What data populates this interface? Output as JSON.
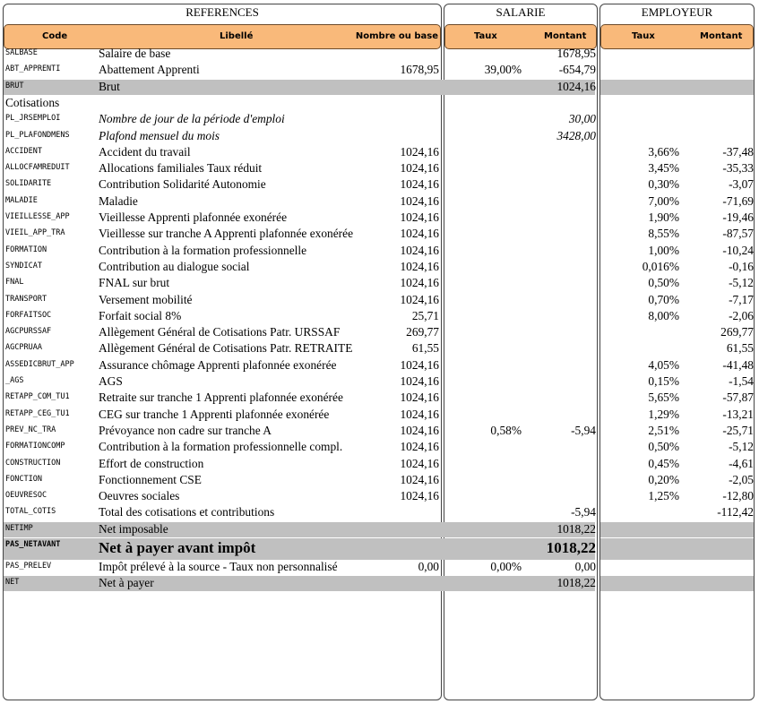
{
  "panels": {
    "references": "REFERENCES",
    "salarie": "SALARIE",
    "employeur": "EMPLOYEUR"
  },
  "headers": {
    "code": "Code",
    "libelle": "Libellé",
    "base": "Nombre ou base",
    "sal_taux": "Taux",
    "sal_montant": "Montant",
    "emp_taux": "Taux",
    "emp_montant": "Montant"
  },
  "rows": [
    {
      "code": "SALBASE",
      "libelle": "Salaire de base",
      "base": "",
      "sal_taux": "",
      "sal_montant": "1678,95",
      "emp_taux": "",
      "emp_montant": ""
    },
    {
      "code": "ABT_APPRENTI",
      "libelle": "Abattement Apprenti",
      "base": "1678,95",
      "sal_taux": "39,00%",
      "sal_montant": "-654,79",
      "emp_taux": "",
      "emp_montant": ""
    },
    {
      "code": "BRUT",
      "libelle": "Brut",
      "base": "",
      "sal_taux": "",
      "sal_montant": "1024,16",
      "emp_taux": "",
      "emp_montant": "",
      "style": "shaded"
    },
    {
      "code": "",
      "libelle": "Cotisations",
      "base": "",
      "sal_taux": "",
      "sal_montant": "",
      "emp_taux": "",
      "emp_montant": "",
      "style": "section"
    },
    {
      "code": "PL_JRSEMPLOI",
      "libelle": "Nombre de jour de la période d'emploi",
      "base": "",
      "sal_taux": "",
      "sal_montant": "30,00",
      "emp_taux": "",
      "emp_montant": "",
      "style": "italic"
    },
    {
      "code": "PL_PLAFONDMENS",
      "libelle": "Plafond mensuel du mois",
      "base": "",
      "sal_taux": "",
      "sal_montant": "3428,00",
      "emp_taux": "",
      "emp_montant": "",
      "style": "italic"
    },
    {
      "code": "ACCIDENT",
      "libelle": "Accident du travail",
      "base": "1024,16",
      "sal_taux": "",
      "sal_montant": "",
      "emp_taux": "3,66%",
      "emp_montant": "-37,48"
    },
    {
      "code": "ALLOCFAMREDUIT",
      "libelle": "Allocations familiales Taux réduit",
      "base": "1024,16",
      "sal_taux": "",
      "sal_montant": "",
      "emp_taux": "3,45%",
      "emp_montant": "-35,33"
    },
    {
      "code": "SOLIDARITE",
      "libelle": "Contribution Solidarité Autonomie",
      "base": "1024,16",
      "sal_taux": "",
      "sal_montant": "",
      "emp_taux": "0,30%",
      "emp_montant": "-3,07"
    },
    {
      "code": "MALADIE",
      "libelle": "Maladie",
      "base": "1024,16",
      "sal_taux": "",
      "sal_montant": "",
      "emp_taux": "7,00%",
      "emp_montant": "-71,69"
    },
    {
      "code": "VIEILLESSE_APP",
      "libelle": "Vieillesse Apprenti plafonnée exonérée",
      "base": "1024,16",
      "sal_taux": "",
      "sal_montant": "",
      "emp_taux": "1,90%",
      "emp_montant": "-19,46"
    },
    {
      "code": "VIEIL_APP_TRA",
      "libelle": "Vieillesse sur tranche A Apprenti plafonnée exonérée",
      "base": "1024,16",
      "sal_taux": "",
      "sal_montant": "",
      "emp_taux": "8,55%",
      "emp_montant": "-87,57"
    },
    {
      "code": "FORMATION",
      "libelle": "Contribution à la formation professionnelle",
      "base": "1024,16",
      "sal_taux": "",
      "sal_montant": "",
      "emp_taux": "1,00%",
      "emp_montant": "-10,24"
    },
    {
      "code": "SYNDICAT",
      "libelle": "Contribution au dialogue social",
      "base": "1024,16",
      "sal_taux": "",
      "sal_montant": "",
      "emp_taux": "0,016%",
      "emp_montant": "-0,16"
    },
    {
      "code": "FNAL",
      "libelle": "FNAL sur brut",
      "base": "1024,16",
      "sal_taux": "",
      "sal_montant": "",
      "emp_taux": "0,50%",
      "emp_montant": "-5,12"
    },
    {
      "code": "TRANSPORT",
      "libelle": "Versement mobilité",
      "base": "1024,16",
      "sal_taux": "",
      "sal_montant": "",
      "emp_taux": "0,70%",
      "emp_montant": "-7,17"
    },
    {
      "code": "FORFAITSOC",
      "libelle": "Forfait social  8%",
      "base": "25,71",
      "sal_taux": "",
      "sal_montant": "",
      "emp_taux": "8,00%",
      "emp_montant": "-2,06"
    },
    {
      "code": "AGCPURSSAF",
      "libelle": "Allègement Général de Cotisations Patr. URSSAF",
      "base": "269,77",
      "sal_taux": "",
      "sal_montant": "",
      "emp_taux": "",
      "emp_montant": "269,77"
    },
    {
      "code": "AGCPRUAA",
      "libelle": "Allègement Général de Cotisations Patr. RETRAITE",
      "base": "61,55",
      "sal_taux": "",
      "sal_montant": "",
      "emp_taux": "",
      "emp_montant": "61,55"
    },
    {
      "code": "ASSEDICBRUT_APP",
      "libelle": "Assurance chômage Apprenti plafonnée exonérée",
      "base": "1024,16",
      "sal_taux": "",
      "sal_montant": "",
      "emp_taux": "4,05%",
      "emp_montant": "-41,48"
    },
    {
      "code": "_AGS",
      "libelle": "AGS",
      "base": "1024,16",
      "sal_taux": "",
      "sal_montant": "",
      "emp_taux": "0,15%",
      "emp_montant": "-1,54"
    },
    {
      "code": "RETAPP_COM_TU1",
      "libelle": "Retraite sur tranche 1 Apprenti plafonnée exonérée",
      "base": "1024,16",
      "sal_taux": "",
      "sal_montant": "",
      "emp_taux": "5,65%",
      "emp_montant": "-57,87"
    },
    {
      "code": "RETAPP_CEG_TU1",
      "libelle": "CEG sur tranche 1 Apprenti plafonnée exonérée",
      "base": "1024,16",
      "sal_taux": "",
      "sal_montant": "",
      "emp_taux": "1,29%",
      "emp_montant": "-13,21"
    },
    {
      "code": "PREV_NC_TRA",
      "libelle": "Prévoyance non cadre sur tranche A",
      "base": "1024,16",
      "sal_taux": "0,58%",
      "sal_montant": "-5,94",
      "emp_taux": "2,51%",
      "emp_montant": "-25,71"
    },
    {
      "code": "FORMATIONCOMP",
      "libelle": "Contribution à la formation professionnelle compl.",
      "base": "1024,16",
      "sal_taux": "",
      "sal_montant": "",
      "emp_taux": "0,50%",
      "emp_montant": "-5,12"
    },
    {
      "code": "CONSTRUCTION",
      "libelle": "Effort de construction",
      "base": "1024,16",
      "sal_taux": "",
      "sal_montant": "",
      "emp_taux": "0,45%",
      "emp_montant": "-4,61"
    },
    {
      "code": "FONCTION",
      "libelle": "Fonctionnement CSE",
      "base": "1024,16",
      "sal_taux": "",
      "sal_montant": "",
      "emp_taux": "0,20%",
      "emp_montant": "-2,05"
    },
    {
      "code": "OEUVRESOC",
      "libelle": "Oeuvres sociales",
      "base": "1024,16",
      "sal_taux": "",
      "sal_montant": "",
      "emp_taux": "1,25%",
      "emp_montant": "-12,80"
    },
    {
      "code": "TOTAL_COTIS",
      "libelle": "Total des cotisations et contributions",
      "base": "",
      "sal_taux": "",
      "sal_montant": "-5,94",
      "emp_taux": "",
      "emp_montant": "-112,42"
    },
    {
      "code": "NETIMP",
      "libelle": "Net imposable",
      "base": "",
      "sal_taux": "",
      "sal_montant": "1018,22",
      "emp_taux": "",
      "emp_montant": "",
      "style": "shaded"
    },
    {
      "code": "PAS_NETAVANT",
      "libelle": "Net à payer avant impôt",
      "base": "",
      "sal_taux": "",
      "sal_montant": "1018,22",
      "emp_taux": "",
      "emp_montant": "",
      "style": "shaded big"
    },
    {
      "code": "PAS_PRELEV",
      "libelle": "Impôt prélevé à la source - Taux non personnalisé",
      "base": "0,00",
      "sal_taux": "0,00%",
      "sal_montant": "0,00",
      "emp_taux": "",
      "emp_montant": ""
    },
    {
      "code": "NET",
      "libelle": "Net à payer",
      "base": "",
      "sal_taux": "",
      "sal_montant": "1018,22",
      "emp_taux": "",
      "emp_montant": "",
      "style": "shaded"
    }
  ]
}
